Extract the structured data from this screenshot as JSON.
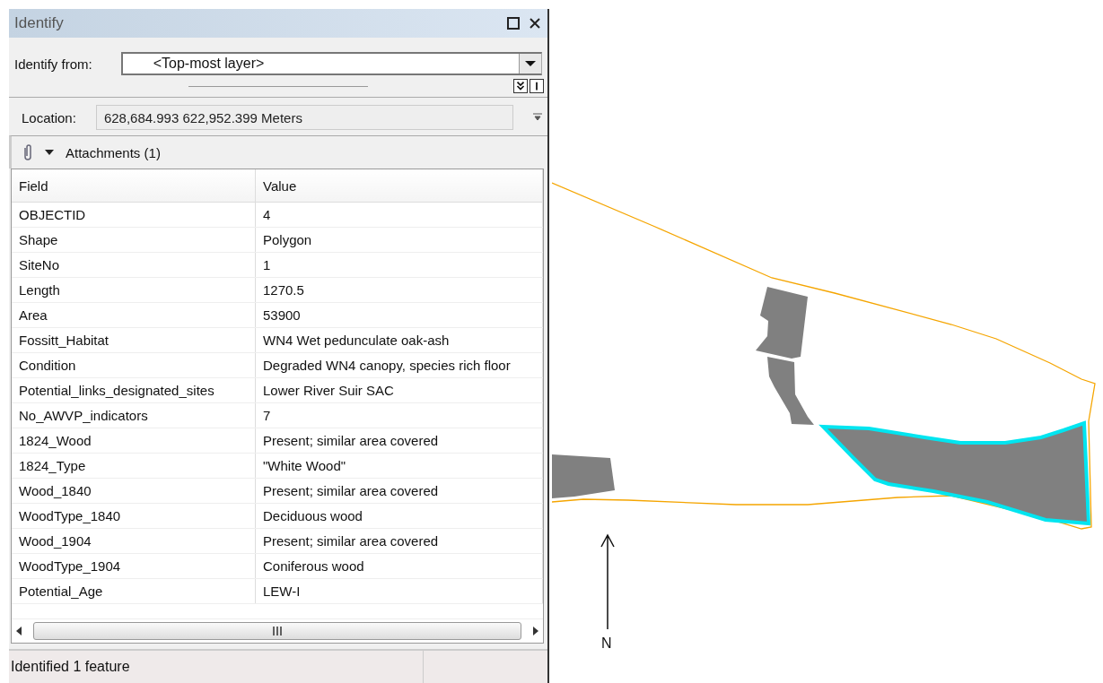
{
  "window": {
    "title": "Identify"
  },
  "identify_from": {
    "label": "Identify from:",
    "value": "<Top-most layer>"
  },
  "location": {
    "label": "Location:",
    "value": "628,684.993  622,952.399 Meters"
  },
  "attachments": {
    "label": "Attachments (1)",
    "expanded": true
  },
  "table": {
    "columns": [
      "Field",
      "Value"
    ],
    "rows": [
      {
        "field": "OBJECTID",
        "value": "4"
      },
      {
        "field": "Shape",
        "value": "Polygon"
      },
      {
        "field": "SiteNo",
        "value": "1"
      },
      {
        "field": "Length",
        "value": "1270.5"
      },
      {
        "field": "Area",
        "value": "53900"
      },
      {
        "field": "Fossitt_Habitat",
        "value": "WN4 Wet pedunculate oak-ash"
      },
      {
        "field": "Condition",
        "value": "Degraded WN4 canopy, species rich floor"
      },
      {
        "field": "Potential_links_designated_sites",
        "value": "Lower River Suir SAC"
      },
      {
        "field": "No_AWVP_indicators",
        "value": "7"
      },
      {
        "field": "1824_Wood",
        "value": "Present; similar area covered"
      },
      {
        "field": "1824_Type",
        "value": "\"White Wood\""
      },
      {
        "field": "Wood_1840",
        "value": "Present; similar area covered"
      },
      {
        "field": "WoodType_1840",
        "value": "Deciduous wood"
      },
      {
        "field": "Wood_1904",
        "value": "Present; similar area covered"
      },
      {
        "field": "WoodType_1904",
        "value": "Coniferous wood"
      },
      {
        "field": "Potential_Age",
        "value": "LEW-I"
      }
    ]
  },
  "status_bar": "Identified 1 feature",
  "map": {
    "north_label": "N"
  }
}
